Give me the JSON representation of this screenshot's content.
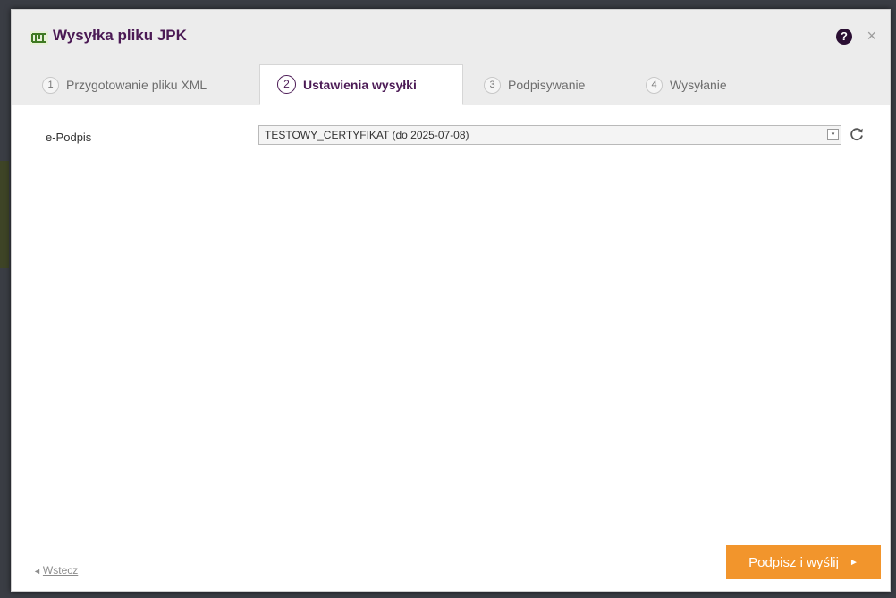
{
  "dialog": {
    "title": "Wysyłka pliku JPK",
    "help_icon": "question-circle-icon",
    "help_glyph": "?",
    "close_icon": "close-icon",
    "close_glyph": "×"
  },
  "tabs": [
    {
      "number": "1",
      "label": "Przygotowanie pliku XML",
      "active": false
    },
    {
      "number": "2",
      "label": "Ustawienia wysyłki",
      "active": true
    },
    {
      "number": "3",
      "label": "Podpisywanie",
      "active": false
    },
    {
      "number": "4",
      "label": "Wysyłanie",
      "active": false
    }
  ],
  "form": {
    "signature_label": "e-Podpis",
    "signature_value": "TESTOWY_CERTYFIKAT (do 2025-07-08)",
    "dropdown_glyph": "▾",
    "refresh_icon": "refresh-icon"
  },
  "footer": {
    "back_arrow": "◄",
    "back_label": "Wstecz",
    "submit_label": "Podpisz i wyślij",
    "submit_arrow": "►"
  },
  "colors": {
    "accent": "#4b1a55",
    "button": "#f2952c",
    "titlebar": "#ececec"
  }
}
